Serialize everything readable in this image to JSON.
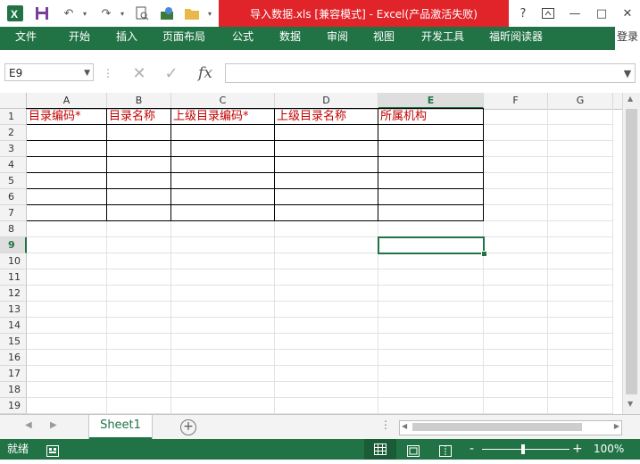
{
  "titlebar": {
    "title": "导入数据.xls  [兼容模式] -  Excel(产品激活失败)",
    "help": "?",
    "minimize": "—",
    "restore": "□",
    "close": "✕"
  },
  "ribbon": {
    "file": "文件",
    "tabs": [
      "开始",
      "插入",
      "页面布局",
      "公式",
      "数据",
      "审阅",
      "视图",
      "开发工具",
      "福昕阅读器"
    ],
    "login": "登录"
  },
  "formula_bar": {
    "name_box": "E9",
    "fx": "fx",
    "value": ""
  },
  "grid": {
    "columns": [
      "A",
      "B",
      "C",
      "D",
      "E",
      "F",
      "G"
    ],
    "rows": [
      "1",
      "2",
      "3",
      "4",
      "5",
      "6",
      "7",
      "8",
      "9",
      "10",
      "11",
      "12",
      "13",
      "14",
      "15",
      "16",
      "17",
      "18",
      "19"
    ],
    "active_cell": "E9",
    "header_row": [
      "目录编码*",
      "目录名称",
      "上级目录编码*",
      "上级目录名称",
      "所属机构"
    ],
    "header_color": "#c00000"
  },
  "sheets": {
    "tabs": [
      "Sheet1"
    ],
    "add": "+"
  },
  "status": {
    "ready": "就绪",
    "zoom": "100%",
    "minus": "-",
    "plus": "+"
  },
  "colors": {
    "accent": "#217346",
    "title_red": "#e0242a"
  }
}
